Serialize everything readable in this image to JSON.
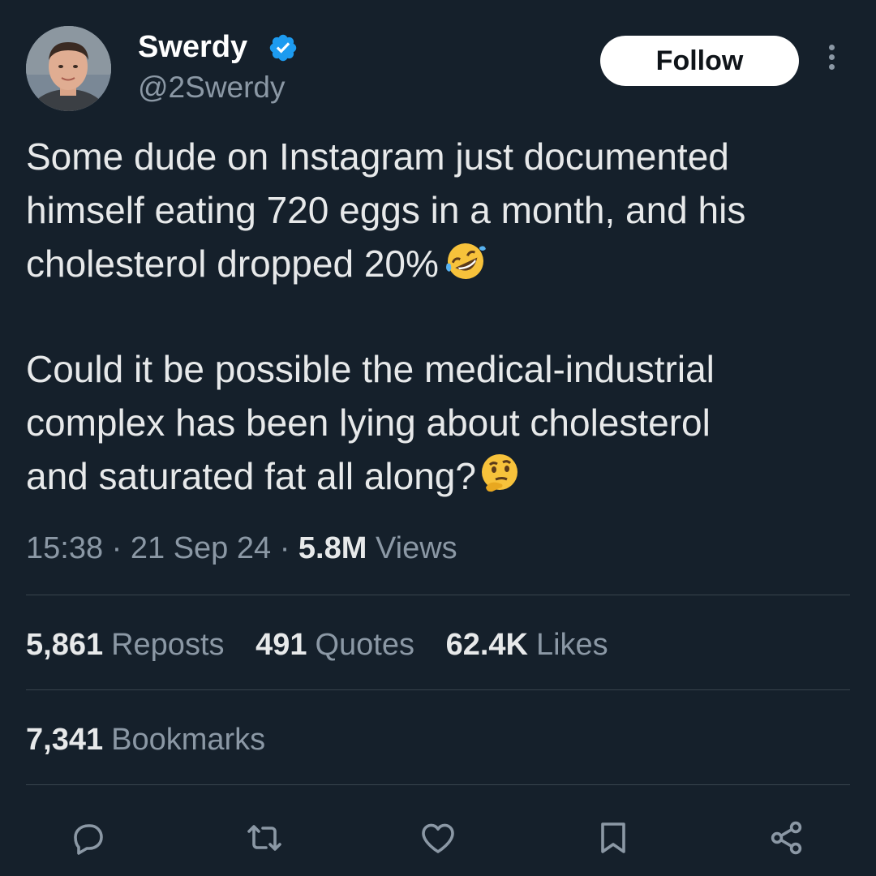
{
  "author": {
    "name": "Swerdy",
    "handle": "@2Swerdy",
    "verified": true
  },
  "follow_label": "Follow",
  "tweet": {
    "paragraph1": [
      "Some dude on Instagram just documented",
      "himself eating 720 eggs in a month, and his",
      "cholesterol dropped 20%"
    ],
    "paragraph1_emoji": "🤣",
    "paragraph2": [
      "Could it be possible the medical-industrial",
      "complex has been lying about cholesterol",
      "and saturated fat all along?"
    ],
    "paragraph2_emoji": "🤔"
  },
  "meta": {
    "time": "15:38",
    "date": "21 Sep 24",
    "views_count": "5.8M",
    "views_label": "Views",
    "separator": "·"
  },
  "stats": {
    "reposts": {
      "count": "5,861",
      "label": "Reposts"
    },
    "quotes": {
      "count": "491",
      "label": "Quotes"
    },
    "likes": {
      "count": "62.4K",
      "label": "Likes"
    },
    "bookmarks": {
      "count": "7,341",
      "label": "Bookmarks"
    }
  },
  "actions": [
    "reply-icon",
    "repost-icon",
    "like-icon",
    "bookmark-icon",
    "share-icon"
  ],
  "colors": {
    "background": "#15202b",
    "primary_text": "#e7e9ea",
    "secondary_text": "#8b98a5",
    "divider": "#38444d",
    "verified_blue": "#1d9bf0",
    "follow_bg": "#ffffff"
  }
}
